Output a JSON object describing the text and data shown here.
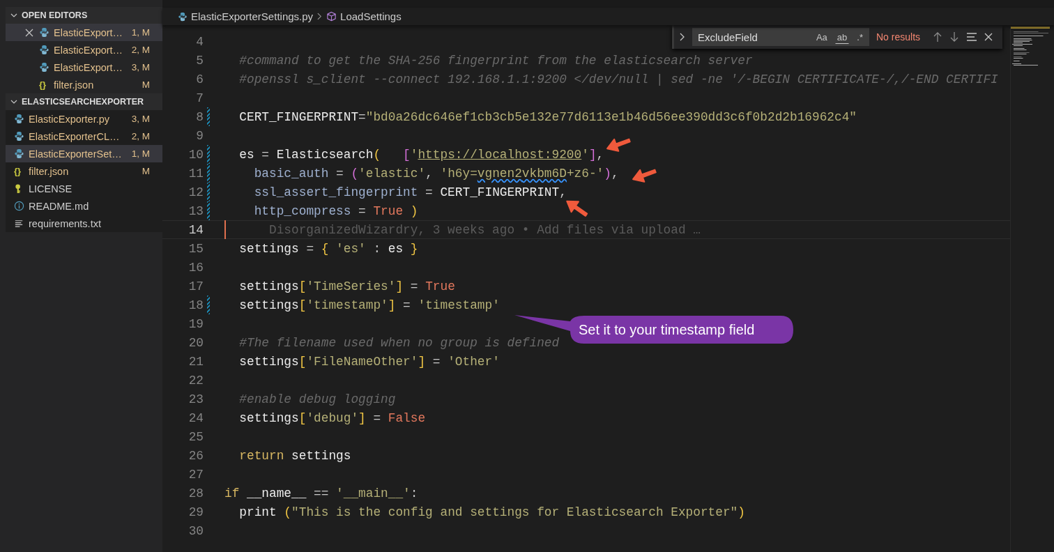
{
  "sidebar": {
    "sections": [
      {
        "title": "OPEN EDITORS",
        "expanded": true,
        "items": [
          {
            "kind": "python",
            "label": "ElasticExport…",
            "badge": "1, M",
            "modified": true,
            "selected": true
          },
          {
            "kind": "python",
            "label": "ElasticExport…",
            "badge": "2, M",
            "modified": true,
            "selected": false
          },
          {
            "kind": "python",
            "label": "ElasticExport…",
            "badge": "3, M",
            "modified": true,
            "selected": false
          },
          {
            "kind": "json",
            "glyph": "{}",
            "label": "filter.json",
            "badge": "M",
            "modified": true,
            "selected": false
          }
        ]
      },
      {
        "title": "ELASTICSEARCHEXPORTER",
        "expanded": true,
        "items": [
          {
            "kind": "python",
            "label": "ElasticExporter.py",
            "badge": "3, M",
            "modified": true,
            "selected": false
          },
          {
            "kind": "python",
            "label": "ElasticExporterCL…",
            "badge": "2, M",
            "modified": true,
            "selected": false
          },
          {
            "kind": "python",
            "label": "ElasticExporterSet…",
            "badge": "1, M",
            "modified": true,
            "selected": true
          },
          {
            "kind": "json",
            "glyph": "{}",
            "label": "filter.json",
            "badge": "M",
            "modified": true,
            "selected": false
          },
          {
            "kind": "license",
            "label": "LICENSE",
            "modified": false,
            "selected": false
          },
          {
            "kind": "info",
            "label": "README.md",
            "modified": false,
            "selected": false
          },
          {
            "kind": "text",
            "label": "requirements.txt",
            "modified": false,
            "selected": false
          }
        ]
      }
    ]
  },
  "breadcrumb": [
    {
      "kind": "python",
      "label": "ElasticExporterSettings.py"
    },
    {
      "kind": "symbol",
      "label": "LoadSettings"
    }
  ],
  "find_widget": {
    "query": "ExcludeField",
    "options": [
      {
        "label": "Aa",
        "selected": false
      },
      {
        "label": "ab",
        "selected": false
      },
      {
        "label": ".*",
        "selected": false
      }
    ],
    "result": "No results"
  },
  "code_lines": [
    {
      "number": "4",
      "modified": false,
      "current": false
    },
    {
      "number": "5",
      "modified": false,
      "current": false,
      "tokens": [
        {
          "kind": "comment",
          "text": "  #command to get the SHA-256 fingerprint from the elasticsearch server"
        }
      ]
    },
    {
      "number": "6",
      "modified": false,
      "current": false,
      "tokens": [
        {
          "kind": "comment",
          "text": "  #openssl s_client --connect 192.168.1.1:9200 </dev/null | sed -ne '/-BEGIN CERTIFICATE-/,/-END CERTIFI"
        }
      ]
    },
    {
      "number": "7",
      "modified": false,
      "current": false
    },
    {
      "number": "8",
      "modified": true,
      "current": false,
      "tokens": [
        {
          "kind": "var",
          "text": "  CERT_FINGERPRINT"
        },
        {
          "kind": "op",
          "text": "="
        },
        {
          "kind": "str",
          "text": "\"bd0a26dc646ef1cb3cb5e132e77d6113e1b46d56ee390dd3c6f0b2d2b16962c4\""
        }
      ]
    },
    {
      "number": "9",
      "modified": false,
      "current": false
    },
    {
      "number": "10",
      "modified": true,
      "current": false,
      "tokens": [
        {
          "kind": "var",
          "text": "  es"
        },
        {
          "kind": "op",
          "text": " = "
        },
        {
          "kind": "var",
          "text": "Elasticsearch"
        },
        {
          "kind": "bracket",
          "text": "("
        },
        {
          "kind": "bracket2",
          "text": "   ["
        },
        {
          "kind": "str",
          "text": "'"
        },
        {
          "kind": "link",
          "text": "https://localhost:9200"
        },
        {
          "kind": "str",
          "text": "'"
        },
        {
          "kind": "bracket2",
          "text": "]"
        },
        {
          "kind": "op",
          "text": ","
        }
      ]
    },
    {
      "number": "11",
      "modified": true,
      "current": false,
      "tokens": [
        {
          "kind": "param",
          "text": "    basic_auth"
        },
        {
          "kind": "op",
          "text": " = "
        },
        {
          "kind": "bracket2",
          "text": "("
        },
        {
          "kind": "str",
          "text": "'elastic'"
        },
        {
          "kind": "op",
          "text": ", "
        },
        {
          "kind": "str",
          "text": "'h6y="
        },
        {
          "kind": "squiggle",
          "text": "vgnen2"
        },
        {
          "kind": "squiggle",
          "text": "vkbm6D"
        },
        {
          "kind": "str",
          "text": "+z6-'"
        },
        {
          "kind": "bracket2",
          "text": ")"
        },
        {
          "kind": "op",
          "text": ","
        }
      ]
    },
    {
      "number": "12",
      "modified": true,
      "current": false,
      "tokens": [
        {
          "kind": "param",
          "text": "    ssl_assert_fingerprint"
        },
        {
          "kind": "op",
          "text": " = "
        },
        {
          "kind": "var",
          "text": "CERT_FINGERPRINT"
        },
        {
          "kind": "op",
          "text": ","
        }
      ]
    },
    {
      "number": "13",
      "modified": true,
      "current": false,
      "tokens": [
        {
          "kind": "param",
          "text": "    http_compress"
        },
        {
          "kind": "op",
          "text": " = "
        },
        {
          "kind": "const",
          "text": "True"
        },
        {
          "kind": "bracket",
          "text": " )"
        }
      ]
    },
    {
      "number": "14",
      "modified": false,
      "current": true,
      "tokens": [
        {
          "kind": "blame",
          "text": "DisorganizedWizardry, 3 weeks ago • Add files via upload …"
        }
      ]
    },
    {
      "number": "15",
      "modified": false,
      "current": false,
      "tokens": [
        {
          "kind": "var",
          "text": "  settings"
        },
        {
          "kind": "op",
          "text": " = "
        },
        {
          "kind": "bracket",
          "text": "{"
        },
        {
          "kind": "str",
          "text": " 'es'"
        },
        {
          "kind": "op",
          "text": " : "
        },
        {
          "kind": "var",
          "text": "es"
        },
        {
          "kind": "bracket",
          "text": " }"
        }
      ]
    },
    {
      "number": "16",
      "modified": false,
      "current": false
    },
    {
      "number": "17",
      "modified": false,
      "current": false,
      "tokens": [
        {
          "kind": "var",
          "text": "  settings"
        },
        {
          "kind": "bracket",
          "text": "["
        },
        {
          "kind": "str",
          "text": "'TimeSeries'"
        },
        {
          "kind": "bracket",
          "text": "]"
        },
        {
          "kind": "op",
          "text": " = "
        },
        {
          "kind": "const",
          "text": "True"
        }
      ]
    },
    {
      "number": "18",
      "modified": true,
      "current": false,
      "tokens": [
        {
          "kind": "var",
          "text": "  settings"
        },
        {
          "kind": "bracket",
          "text": "["
        },
        {
          "kind": "str",
          "text": "'timestamp'"
        },
        {
          "kind": "bracket",
          "text": "]"
        },
        {
          "kind": "op",
          "text": " = "
        },
        {
          "kind": "str",
          "text": "'timestamp'"
        }
      ]
    },
    {
      "number": "19",
      "modified": false,
      "current": false
    },
    {
      "number": "20",
      "modified": false,
      "current": false,
      "tokens": [
        {
          "kind": "comment",
          "text": "  #The filename used when no group is defined"
        }
      ]
    },
    {
      "number": "21",
      "modified": false,
      "current": false,
      "tokens": [
        {
          "kind": "var",
          "text": "  settings"
        },
        {
          "kind": "bracket",
          "text": "["
        },
        {
          "kind": "str",
          "text": "'FileNameOther'"
        },
        {
          "kind": "bracket",
          "text": "]"
        },
        {
          "kind": "op",
          "text": " = "
        },
        {
          "kind": "str",
          "text": "'Other'"
        }
      ]
    },
    {
      "number": "22",
      "modified": false,
      "current": false
    },
    {
      "number": "23",
      "modified": false,
      "current": false,
      "tokens": [
        {
          "kind": "comment",
          "text": "  #enable debug logging"
        }
      ]
    },
    {
      "number": "24",
      "modified": false,
      "current": false,
      "tokens": [
        {
          "kind": "var",
          "text": "  settings"
        },
        {
          "kind": "bracket",
          "text": "["
        },
        {
          "kind": "str",
          "text": "'debug'"
        },
        {
          "kind": "bracket",
          "text": "]"
        },
        {
          "kind": "op",
          "text": " = "
        },
        {
          "kind": "const",
          "text": "False"
        }
      ]
    },
    {
      "number": "25",
      "modified": false,
      "current": false
    },
    {
      "number": "26",
      "modified": false,
      "current": false,
      "tokens": [
        {
          "kind": "kw",
          "text": "  return"
        },
        {
          "kind": "var",
          "text": " settings"
        }
      ]
    },
    {
      "number": "27",
      "modified": false,
      "current": false
    },
    {
      "number": "28",
      "modified": false,
      "current": false,
      "tokens": [
        {
          "kind": "kw",
          "text": "if"
        },
        {
          "kind": "var",
          "text": " __name__"
        },
        {
          "kind": "op",
          "text": " == "
        },
        {
          "kind": "str",
          "text": "'__main__'"
        },
        {
          "kind": "op",
          "text": ":"
        }
      ]
    },
    {
      "number": "29",
      "modified": false,
      "current": false,
      "tokens": [
        {
          "kind": "var",
          "text": "  print"
        },
        {
          "kind": "bracket",
          "text": " ("
        },
        {
          "kind": "str",
          "text": "\"This is the config and settings for Elasticsearch Exporter\""
        },
        {
          "kind": "bracket",
          "text": ")"
        }
      ]
    },
    {
      "number": "30",
      "modified": false,
      "current": false
    }
  ],
  "callout": {
    "text": "Set it to your timestamp field"
  }
}
